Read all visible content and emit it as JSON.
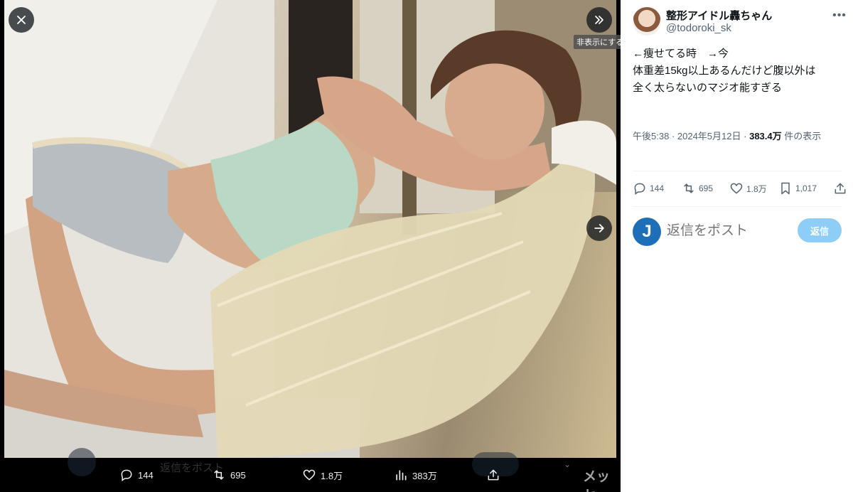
{
  "viewer": {
    "tooltip": "非表示にする",
    "ghost": {
      "reply_placeholder": "返信をポスト",
      "message_label": "メッセ"
    },
    "bar_actions": [
      {
        "icon": "reply-icon",
        "count": "144"
      },
      {
        "icon": "repost-icon",
        "count": "695"
      },
      {
        "icon": "like-icon",
        "count": "1.8万"
      },
      {
        "icon": "views-icon",
        "count": "383万"
      },
      {
        "icon": "share-icon",
        "count": ""
      }
    ]
  },
  "tweet": {
    "display_name": "整形アイドル轟ちゃん",
    "handle": "@todoroki_sk",
    "text_lines": [
      "←痩せてる時　→今",
      "",
      "体重差15kg以上あるんだけど腹以外は",
      "全く太らないのマジオ能すぎる"
    ],
    "time": "午後5:38",
    "date": "2024年5月12日",
    "views_count": "383.4万",
    "views_label": "件の表示",
    "actions": {
      "replies": "144",
      "reposts": "695",
      "likes": "1.8万",
      "bookmarks": "1,017"
    },
    "reply_box": {
      "avatar_letter": "J",
      "placeholder": "返信をポスト",
      "button_label": "返信"
    }
  },
  "colors": {
    "accent": "#1d9bf0",
    "reply_button": "#8ecdf7",
    "muted_text": "#536471"
  }
}
